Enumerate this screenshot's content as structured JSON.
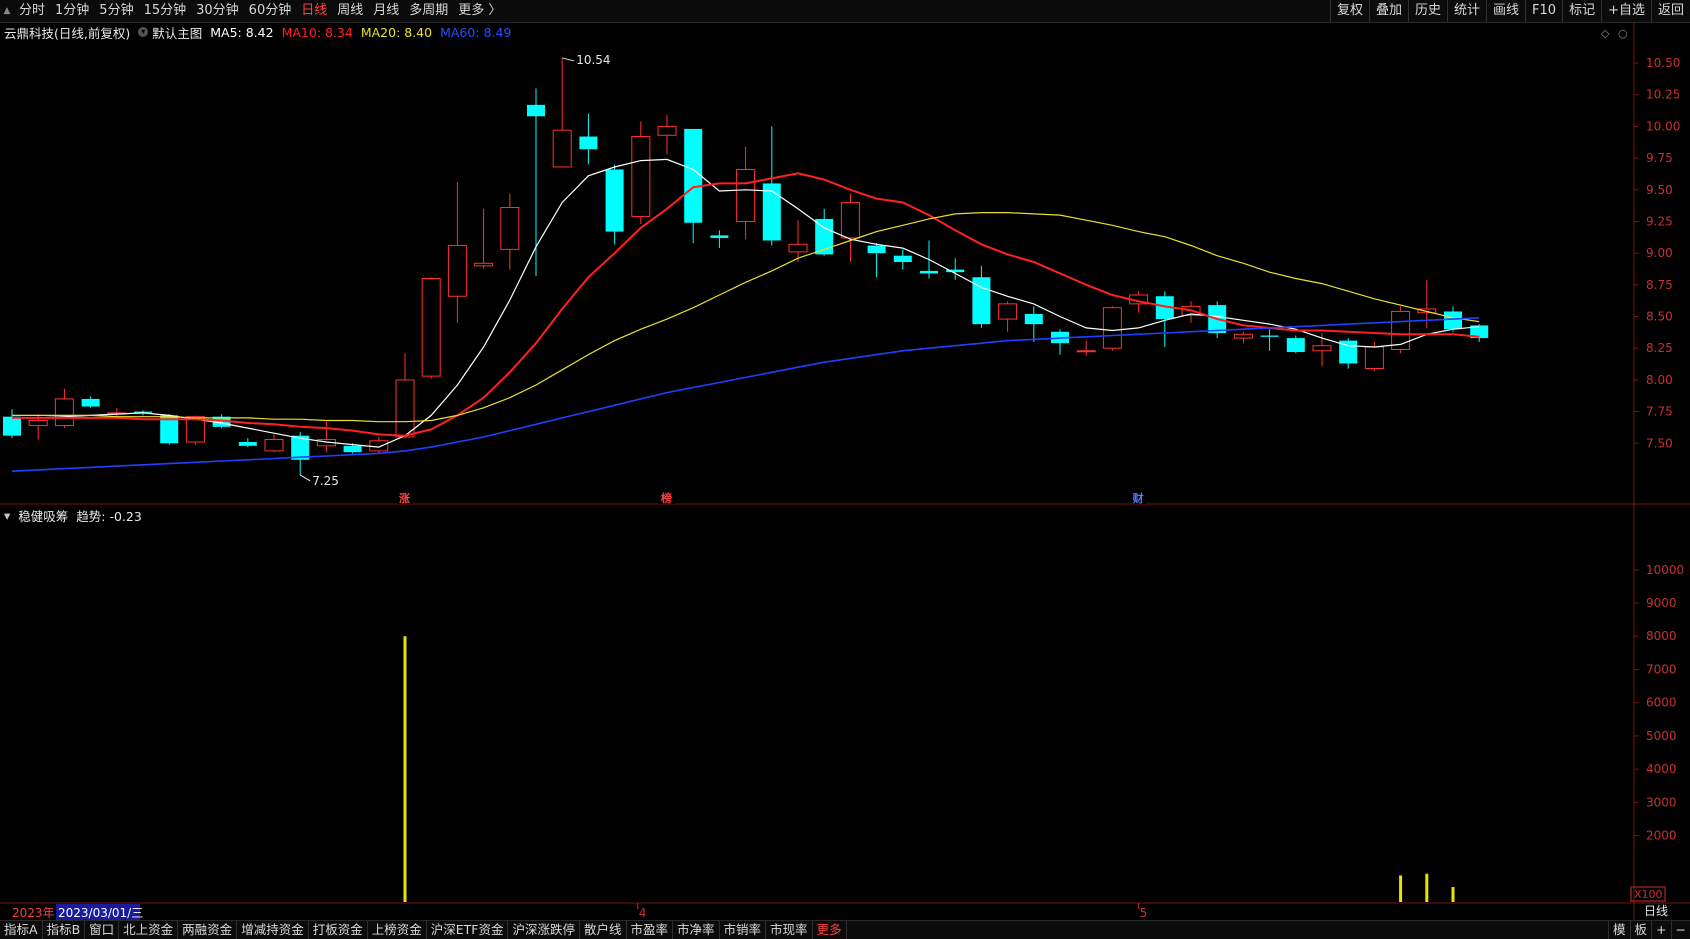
{
  "toolbar": {
    "period_tabs": [
      "分时",
      "1分钟",
      "5分钟",
      "15分钟",
      "30分钟",
      "60分钟",
      "日线",
      "周线",
      "月线",
      "多周期",
      "更多 〉"
    ],
    "active_tab": "日线",
    "right_tools": [
      "复权",
      "叠加",
      "历史",
      "统计",
      "画线",
      "F10",
      "标记",
      "+自选",
      "返回"
    ]
  },
  "main_legend": {
    "title": "云鼎科技(日线,前复权)",
    "template": "默认主图",
    "ma5": "MA5: 8.42",
    "ma10": "MA10: 8.34",
    "ma20": "MA20: 8.40",
    "ma60": "MA60: 8.49",
    "colors": {
      "ma5": "#ffffff",
      "ma10": "#ff2020",
      "ma20": "#e8e030",
      "ma60": "#2040ff",
      "up": "#ff3030",
      "down": "#00ffff"
    }
  },
  "sub_legend": {
    "title": "稳健吸筹",
    "trend": "趋势: -0.23"
  },
  "bottom_tabs": [
    "指标A",
    "指标B",
    "窗口",
    "北上资金",
    "两融资金",
    "增减持资金",
    "打板资金",
    "上榜资金",
    "沪深ETF资金",
    "沪深涨跌停",
    "散户线",
    "市盈率",
    "市净率",
    "市销率",
    "市现率",
    "更多"
  ],
  "bottom_right": [
    "模",
    "板",
    "+",
    "−"
  ],
  "chart_data": [
    {
      "type": "candlestick",
      "ylim": [
        7.1,
        10.65
      ],
      "y_ticks": [
        "10.50",
        "10.25",
        "10.00",
        "9.75",
        "9.50",
        "9.25",
        "9.00",
        "8.75",
        "8.50",
        "8.25",
        "8.00",
        "7.75",
        "7.50"
      ],
      "period_label": "日线",
      "annotations": {
        "high": "10.54",
        "low": "7.25",
        "markers": [
          "涨",
          "榜",
          "财"
        ]
      },
      "x_axis": {
        "year": "2023年",
        "cursor_date": "2023/03/01/三",
        "months": [
          "4",
          "5"
        ]
      },
      "candles": [
        {
          "o": 7.71,
          "c": 7.56,
          "h": 7.77,
          "l": 7.54
        },
        {
          "o": 7.64,
          "c": 7.68,
          "h": 7.73,
          "l": 7.53
        },
        {
          "o": 7.64,
          "c": 7.85,
          "h": 7.93,
          "l": 7.62
        },
        {
          "o": 7.85,
          "c": 7.79,
          "h": 7.87,
          "l": 7.78
        },
        {
          "o": 7.74,
          "c": 7.74,
          "h": 7.78,
          "l": 7.69
        },
        {
          "o": 7.75,
          "c": 7.74,
          "h": 7.76,
          "l": 7.72
        },
        {
          "o": 7.72,
          "c": 7.5,
          "h": 7.73,
          "l": 7.49
        },
        {
          "o": 7.51,
          "c": 7.71,
          "h": 7.72,
          "l": 7.49
        },
        {
          "o": 7.71,
          "c": 7.63,
          "h": 7.73,
          "l": 7.62
        },
        {
          "o": 7.51,
          "c": 7.48,
          "h": 7.54,
          "l": 7.47
        },
        {
          "o": 7.44,
          "c": 7.53,
          "h": 7.57,
          "l": 7.43
        },
        {
          "o": 7.56,
          "c": 7.37,
          "h": 7.59,
          "l": 7.25
        },
        {
          "o": 7.48,
          "c": 7.53,
          "h": 7.67,
          "l": 7.43
        },
        {
          "o": 7.48,
          "c": 7.43,
          "h": 7.5,
          "l": 7.42
        },
        {
          "o": 7.44,
          "c": 7.52,
          "h": 7.55,
          "l": 7.42
        },
        {
          "o": 7.55,
          "c": 8.0,
          "h": 8.21,
          "l": 7.54
        },
        {
          "o": 8.03,
          "c": 8.8,
          "h": 8.81,
          "l": 8.01
        },
        {
          "o": 8.66,
          "c": 9.06,
          "h": 9.56,
          "l": 8.45
        },
        {
          "o": 8.9,
          "c": 8.92,
          "h": 9.35,
          "l": 8.88
        },
        {
          "o": 9.03,
          "c": 9.36,
          "h": 9.47,
          "l": 8.87
        },
        {
          "o": 10.17,
          "c": 10.08,
          "h": 10.3,
          "l": 8.82
        },
        {
          "o": 9.68,
          "c": 9.97,
          "h": 10.54,
          "l": 9.68
        },
        {
          "o": 9.92,
          "c": 9.82,
          "h": 10.1,
          "l": 9.7
        },
        {
          "o": 9.66,
          "c": 9.17,
          "h": 9.7,
          "l": 9.07
        },
        {
          "o": 9.29,
          "c": 9.92,
          "h": 10.04,
          "l": 9.23
        },
        {
          "o": 9.93,
          "c": 10.0,
          "h": 10.09,
          "l": 9.78
        },
        {
          "o": 9.98,
          "c": 9.24,
          "h": 9.98,
          "l": 9.08
        },
        {
          "o": 9.14,
          "c": 9.12,
          "h": 9.18,
          "l": 9.04
        },
        {
          "o": 9.25,
          "c": 9.66,
          "h": 9.84,
          "l": 9.11
        },
        {
          "o": 9.55,
          "c": 9.1,
          "h": 10.0,
          "l": 9.06
        },
        {
          "o": 9.01,
          "c": 9.07,
          "h": 9.26,
          "l": 8.93
        },
        {
          "o": 9.27,
          "c": 8.99,
          "h": 9.35,
          "l": 8.98
        },
        {
          "o": 9.12,
          "c": 9.4,
          "h": 9.47,
          "l": 8.93
        },
        {
          "o": 9.06,
          "c": 9.0,
          "h": 9.08,
          "l": 8.81
        },
        {
          "o": 8.98,
          "c": 8.93,
          "h": 9.03,
          "l": 8.87
        },
        {
          "o": 8.86,
          "c": 8.84,
          "h": 9.1,
          "l": 8.8
        },
        {
          "o": 8.87,
          "c": 8.85,
          "h": 8.96,
          "l": 8.79
        },
        {
          "o": 8.81,
          "c": 8.44,
          "h": 8.9,
          "l": 8.41
        },
        {
          "o": 8.48,
          "c": 8.6,
          "h": 8.62,
          "l": 8.38
        },
        {
          "o": 8.52,
          "c": 8.44,
          "h": 8.58,
          "l": 8.3
        },
        {
          "o": 8.38,
          "c": 8.29,
          "h": 8.4,
          "l": 8.2
        },
        {
          "o": 8.23,
          "c": 8.23,
          "h": 8.31,
          "l": 8.19
        },
        {
          "o": 8.25,
          "c": 8.57,
          "h": 8.58,
          "l": 8.23
        },
        {
          "o": 8.6,
          "c": 8.67,
          "h": 8.7,
          "l": 8.53
        },
        {
          "o": 8.66,
          "c": 8.48,
          "h": 8.7,
          "l": 8.26
        },
        {
          "o": 8.51,
          "c": 8.58,
          "h": 8.62,
          "l": 8.45
        },
        {
          "o": 8.59,
          "c": 8.37,
          "h": 8.62,
          "l": 8.33
        },
        {
          "o": 8.33,
          "c": 8.36,
          "h": 8.38,
          "l": 8.29
        },
        {
          "o": 8.35,
          "c": 8.34,
          "h": 8.4,
          "l": 8.23
        },
        {
          "o": 8.33,
          "c": 8.22,
          "h": 8.35,
          "l": 8.21
        },
        {
          "o": 8.23,
          "c": 8.27,
          "h": 8.37,
          "l": 8.11
        },
        {
          "o": 8.31,
          "c": 8.13,
          "h": 8.33,
          "l": 8.09
        },
        {
          "o": 8.09,
          "c": 8.26,
          "h": 8.3,
          "l": 8.07
        },
        {
          "o": 8.24,
          "c": 8.54,
          "h": 8.58,
          "l": 8.21
        },
        {
          "o": 8.53,
          "c": 8.56,
          "h": 8.79,
          "l": 8.41
        },
        {
          "o": 8.54,
          "c": 8.4,
          "h": 8.58,
          "l": 8.38
        },
        {
          "o": 8.43,
          "c": 8.33,
          "h": 8.44,
          "l": 8.3
        }
      ],
      "series": [
        {
          "name": "MA5",
          "values": [
            7.7,
            7.7,
            7.71,
            7.72,
            7.73,
            7.74,
            7.72,
            7.69,
            7.66,
            7.62,
            7.58,
            7.54,
            7.51,
            7.49,
            7.47,
            7.56,
            7.72,
            7.96,
            8.26,
            8.63,
            9.05,
            9.4,
            9.61,
            9.68,
            9.73,
            9.74,
            9.66,
            9.49,
            9.5,
            9.49,
            9.35,
            9.2,
            9.11,
            9.07,
            9.04,
            8.95,
            8.84,
            8.73,
            8.66,
            8.6,
            8.5,
            8.41,
            8.39,
            8.41,
            8.47,
            8.52,
            8.5,
            8.47,
            8.44,
            8.4,
            8.33,
            8.27,
            8.26,
            8.28,
            8.36,
            8.4,
            8.42
          ]
        },
        {
          "name": "MA10",
          "values": [
            7.7,
            7.7,
            7.7,
            7.7,
            7.7,
            7.69,
            7.69,
            7.69,
            7.68,
            7.66,
            7.65,
            7.63,
            7.62,
            7.6,
            7.57,
            7.56,
            7.61,
            7.72,
            7.86,
            8.06,
            8.29,
            8.56,
            8.81,
            9.0,
            9.2,
            9.35,
            9.52,
            9.55,
            9.55,
            9.59,
            9.63,
            9.58,
            9.5,
            9.43,
            9.4,
            9.3,
            9.18,
            9.07,
            8.99,
            8.93,
            8.84,
            8.75,
            8.67,
            8.62,
            8.58,
            8.55,
            8.48,
            8.43,
            8.41,
            8.39,
            8.39,
            8.38,
            8.37,
            8.36,
            8.36,
            8.36,
            8.34
          ]
        },
        {
          "name": "MA20",
          "values": [
            7.72,
            7.72,
            7.72,
            7.72,
            7.71,
            7.71,
            7.71,
            7.7,
            7.7,
            7.7,
            7.69,
            7.69,
            7.68,
            7.68,
            7.67,
            7.67,
            7.68,
            7.72,
            7.78,
            7.86,
            7.96,
            8.08,
            8.2,
            8.31,
            8.4,
            8.48,
            8.57,
            8.67,
            8.77,
            8.86,
            8.96,
            9.03,
            9.1,
            9.17,
            9.22,
            9.27,
            9.31,
            9.32,
            9.32,
            9.31,
            9.3,
            9.26,
            9.22,
            9.17,
            9.13,
            9.06,
            8.98,
            8.92,
            8.85,
            8.8,
            8.76,
            8.7,
            8.64,
            8.59,
            8.54,
            8.49,
            8.46
          ]
        },
        {
          "name": "MA60",
          "values": [
            7.28,
            7.29,
            7.3,
            7.31,
            7.32,
            7.33,
            7.34,
            7.35,
            7.36,
            7.37,
            7.38,
            7.39,
            7.4,
            7.41,
            7.42,
            7.44,
            7.47,
            7.51,
            7.55,
            7.6,
            7.65,
            7.7,
            7.75,
            7.8,
            7.85,
            7.9,
            7.94,
            7.98,
            8.02,
            8.06,
            8.1,
            8.14,
            8.17,
            8.2,
            8.23,
            8.25,
            8.27,
            8.29,
            8.31,
            8.32,
            8.33,
            8.34,
            8.35,
            8.36,
            8.37,
            8.38,
            8.39,
            8.4,
            8.41,
            8.42,
            8.43,
            8.44,
            8.45,
            8.46,
            8.47,
            8.48,
            8.49
          ]
        }
      ]
    },
    {
      "type": "bar",
      "title": "稳健吸筹",
      "ylim": [
        0,
        11800
      ],
      "y_ticks": [
        "10000",
        "9000",
        "8000",
        "7000",
        "6000",
        "5000",
        "4000",
        "3000",
        "2000"
      ],
      "y_unit": "X100",
      "bars": [
        {
          "index": 15,
          "value": 8000
        },
        {
          "index": 53,
          "value": 800
        },
        {
          "index": 54,
          "value": 850
        },
        {
          "index": 55,
          "value": 450
        }
      ]
    }
  ]
}
